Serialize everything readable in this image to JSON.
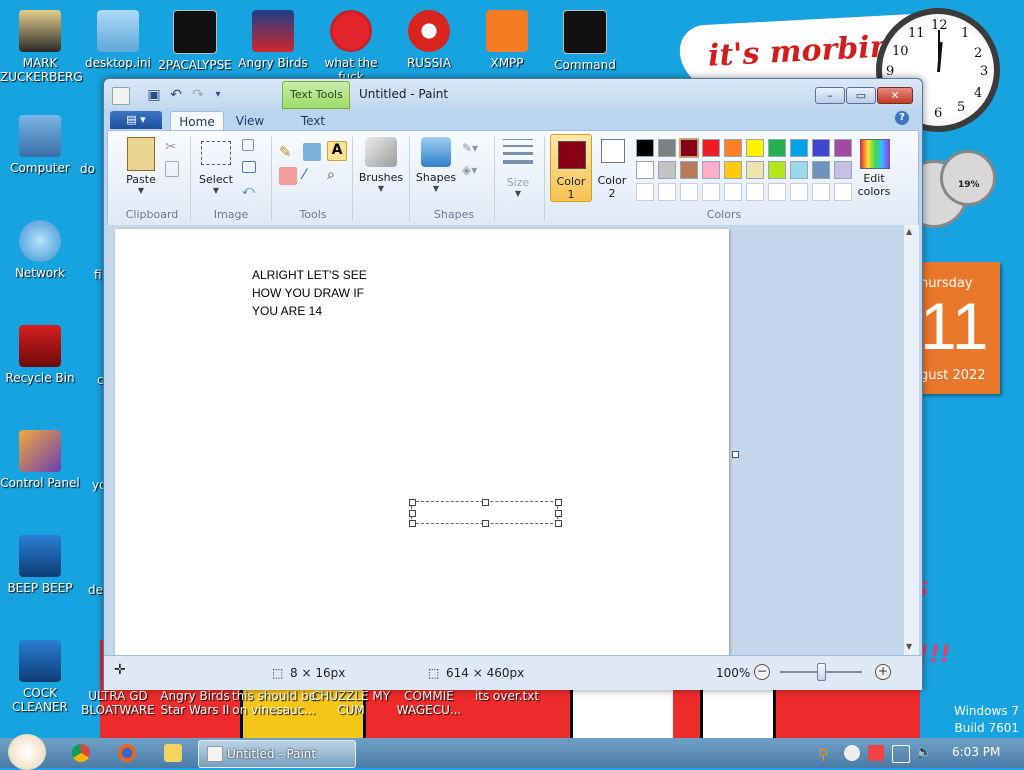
{
  "desktop": {
    "left_icons": [
      {
        "label": "MARK\nZUCKERBERG",
        "icon": "zuckerberg-icon"
      },
      {
        "label": "Computer",
        "icon": "computer-icon"
      },
      {
        "label": "Network",
        "icon": "network-icon"
      },
      {
        "label": "Recycle Bin",
        "icon": "recycle-bin-icon"
      },
      {
        "label": "Control Panel",
        "icon": "control-panel-icon"
      },
      {
        "label": "BEEP BEEP",
        "icon": "beep-icon"
      },
      {
        "label": "COCK\nCLEANER",
        "icon": "cleaner-icon"
      }
    ],
    "col2_partial": [
      {
        "label": "do",
        "icon": "doc-icon"
      },
      {
        "label": "fi",
        "icon": "file-icon"
      },
      {
        "label": "c",
        "icon": "file-icon"
      },
      {
        "label": "yo",
        "icon": "file-icon"
      },
      {
        "label": "de",
        "icon": "file-icon"
      }
    ],
    "top_icons": [
      {
        "label": "desktop.ini",
        "icon": "ini-file-icon"
      },
      {
        "label": "2PACALYPSE",
        "icon": "cmd-icon"
      },
      {
        "label": "Angry Birds",
        "icon": "angry-birds-star-wars-icon"
      },
      {
        "label": "what the fuck",
        "icon": "angry-bird-icon"
      },
      {
        "label": "RUSSIA",
        "icon": "radiation-icon"
      },
      {
        "label": "XMPP",
        "icon": "xampp-icon"
      },
      {
        "label": "Command",
        "icon": "cmd-icon"
      }
    ],
    "bottom_icons": [
      {
        "label": "ULTRA GD\nBLOATWARE",
        "icon": "bloatware-icon"
      },
      {
        "label": "Angry Birds\nStar Wars II",
        "icon": "angry-birds-icon"
      },
      {
        "label": "this should be\non vinesauc...",
        "icon": "file-icon"
      },
      {
        "label": "CHUZZLE MY\nCUM",
        "icon": "file-icon"
      },
      {
        "label": "COMMIE\nWAGECU...",
        "icon": "file-icon"
      },
      {
        "label": "its over.txt",
        "icon": "txt-file-icon"
      }
    ],
    "banner_text": "it's morbin",
    "fragment_s": "s",
    "fragment_bang": "!!!",
    "watermark": [
      "Windows 7",
      "Build 7601"
    ]
  },
  "clock": {
    "numbers": [
      "12",
      "1",
      "2",
      "3",
      "4",
      "5",
      "6",
      "7",
      "8",
      "9",
      "10",
      "11"
    ]
  },
  "meter": {
    "percent": "19%"
  },
  "calendar": {
    "day": "hursday",
    "date": "11",
    "month": "gust 2022"
  },
  "paint": {
    "title": "Untitled - Paint",
    "contextual_tab": "Text Tools",
    "tabs": [
      "Home",
      "View",
      "Text"
    ],
    "active_tab": "Home",
    "groups": {
      "clipboard": {
        "label": "Clipboard",
        "paste": "Paste"
      },
      "image": {
        "label": "Image",
        "select": "Select"
      },
      "tools": {
        "label": "Tools"
      },
      "brushes": {
        "label": "Brushes"
      },
      "shapes": {
        "label": "Shapes",
        "button": "Shapes"
      },
      "size": {
        "label": "Size"
      },
      "colors": {
        "label": "Colors",
        "color1": "Color\n1",
        "color2": "Color\n2",
        "edit": "Edit\ncolors"
      }
    },
    "palette_row1": [
      "#000000",
      "#7f7f7f",
      "#880015",
      "#ed1c24",
      "#ff7f27",
      "#fff200",
      "#22b14c",
      "#00a2e8",
      "#3f48cc",
      "#a349a4"
    ],
    "palette_row2": [
      "#ffffff",
      "#c3c3c3",
      "#b97a57",
      "#ffaec9",
      "#ffc90e",
      "#efe4b0",
      "#b5e61d",
      "#99d9ea",
      "#7092be",
      "#c8bfe7"
    ],
    "palette_row3": [
      "#ffffff",
      "#ffffff",
      "#ffffff",
      "#ffffff",
      "#ffffff",
      "#ffffff",
      "#ffffff",
      "#ffffff",
      "#ffffff",
      "#ffffff"
    ],
    "color1_value": "#880015",
    "color2_value": "#ffffff",
    "canvas_text": [
      "ALRIGHT LET'S SEE",
      "HOW YOU DRAW IF",
      "YOU ARE 14"
    ],
    "status": {
      "cursor_size": "8 × 16px",
      "canvas_size": "614 × 460px",
      "zoom": "100%"
    }
  },
  "taskbar": {
    "active_task": "Untitled - Paint",
    "time": "6:03 PM"
  }
}
